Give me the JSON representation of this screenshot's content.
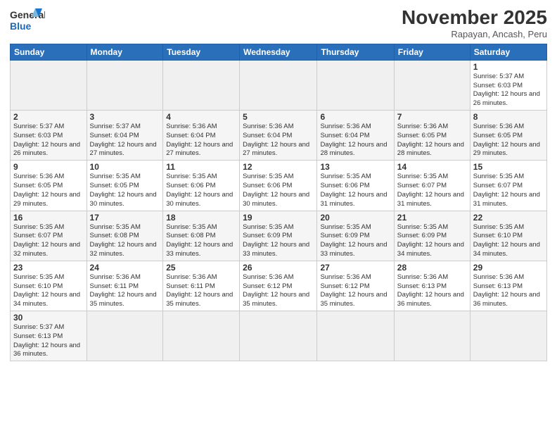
{
  "header": {
    "logo_general": "General",
    "logo_blue": "Blue",
    "month_title": "November 2025",
    "location": "Rapayan, Ancash, Peru"
  },
  "days_of_week": [
    "Sunday",
    "Monday",
    "Tuesday",
    "Wednesday",
    "Thursday",
    "Friday",
    "Saturday"
  ],
  "weeks": [
    [
      {
        "day": "",
        "info": ""
      },
      {
        "day": "",
        "info": ""
      },
      {
        "day": "",
        "info": ""
      },
      {
        "day": "",
        "info": ""
      },
      {
        "day": "",
        "info": ""
      },
      {
        "day": "",
        "info": ""
      },
      {
        "day": "1",
        "info": "Sunrise: 5:37 AM\nSunset: 6:03 PM\nDaylight: 12 hours and 26 minutes."
      }
    ],
    [
      {
        "day": "2",
        "info": "Sunrise: 5:37 AM\nSunset: 6:03 PM\nDaylight: 12 hours and 26 minutes."
      },
      {
        "day": "3",
        "info": "Sunrise: 5:37 AM\nSunset: 6:04 PM\nDaylight: 12 hours and 27 minutes."
      },
      {
        "day": "4",
        "info": "Sunrise: 5:36 AM\nSunset: 6:04 PM\nDaylight: 12 hours and 27 minutes."
      },
      {
        "day": "5",
        "info": "Sunrise: 5:36 AM\nSunset: 6:04 PM\nDaylight: 12 hours and 27 minutes."
      },
      {
        "day": "6",
        "info": "Sunrise: 5:36 AM\nSunset: 6:04 PM\nDaylight: 12 hours and 28 minutes."
      },
      {
        "day": "7",
        "info": "Sunrise: 5:36 AM\nSunset: 6:05 PM\nDaylight: 12 hours and 28 minutes."
      },
      {
        "day": "8",
        "info": "Sunrise: 5:36 AM\nSunset: 6:05 PM\nDaylight: 12 hours and 29 minutes."
      }
    ],
    [
      {
        "day": "9",
        "info": "Sunrise: 5:36 AM\nSunset: 6:05 PM\nDaylight: 12 hours and 29 minutes."
      },
      {
        "day": "10",
        "info": "Sunrise: 5:35 AM\nSunset: 6:05 PM\nDaylight: 12 hours and 30 minutes."
      },
      {
        "day": "11",
        "info": "Sunrise: 5:35 AM\nSunset: 6:06 PM\nDaylight: 12 hours and 30 minutes."
      },
      {
        "day": "12",
        "info": "Sunrise: 5:35 AM\nSunset: 6:06 PM\nDaylight: 12 hours and 30 minutes."
      },
      {
        "day": "13",
        "info": "Sunrise: 5:35 AM\nSunset: 6:06 PM\nDaylight: 12 hours and 31 minutes."
      },
      {
        "day": "14",
        "info": "Sunrise: 5:35 AM\nSunset: 6:07 PM\nDaylight: 12 hours and 31 minutes."
      },
      {
        "day": "15",
        "info": "Sunrise: 5:35 AM\nSunset: 6:07 PM\nDaylight: 12 hours and 31 minutes."
      }
    ],
    [
      {
        "day": "16",
        "info": "Sunrise: 5:35 AM\nSunset: 6:07 PM\nDaylight: 12 hours and 32 minutes."
      },
      {
        "day": "17",
        "info": "Sunrise: 5:35 AM\nSunset: 6:08 PM\nDaylight: 12 hours and 32 minutes."
      },
      {
        "day": "18",
        "info": "Sunrise: 5:35 AM\nSunset: 6:08 PM\nDaylight: 12 hours and 33 minutes."
      },
      {
        "day": "19",
        "info": "Sunrise: 5:35 AM\nSunset: 6:09 PM\nDaylight: 12 hours and 33 minutes."
      },
      {
        "day": "20",
        "info": "Sunrise: 5:35 AM\nSunset: 6:09 PM\nDaylight: 12 hours and 33 minutes."
      },
      {
        "day": "21",
        "info": "Sunrise: 5:35 AM\nSunset: 6:09 PM\nDaylight: 12 hours and 34 minutes."
      },
      {
        "day": "22",
        "info": "Sunrise: 5:35 AM\nSunset: 6:10 PM\nDaylight: 12 hours and 34 minutes."
      }
    ],
    [
      {
        "day": "23",
        "info": "Sunrise: 5:35 AM\nSunset: 6:10 PM\nDaylight: 12 hours and 34 minutes."
      },
      {
        "day": "24",
        "info": "Sunrise: 5:36 AM\nSunset: 6:11 PM\nDaylight: 12 hours and 35 minutes."
      },
      {
        "day": "25",
        "info": "Sunrise: 5:36 AM\nSunset: 6:11 PM\nDaylight: 12 hours and 35 minutes."
      },
      {
        "day": "26",
        "info": "Sunrise: 5:36 AM\nSunset: 6:12 PM\nDaylight: 12 hours and 35 minutes."
      },
      {
        "day": "27",
        "info": "Sunrise: 5:36 AM\nSunset: 6:12 PM\nDaylight: 12 hours and 35 minutes."
      },
      {
        "day": "28",
        "info": "Sunrise: 5:36 AM\nSunset: 6:13 PM\nDaylight: 12 hours and 36 minutes."
      },
      {
        "day": "29",
        "info": "Sunrise: 5:36 AM\nSunset: 6:13 PM\nDaylight: 12 hours and 36 minutes."
      }
    ],
    [
      {
        "day": "30",
        "info": "Sunrise: 5:37 AM\nSunset: 6:13 PM\nDaylight: 12 hours and 36 minutes."
      },
      {
        "day": "",
        "info": ""
      },
      {
        "day": "",
        "info": ""
      },
      {
        "day": "",
        "info": ""
      },
      {
        "day": "",
        "info": ""
      },
      {
        "day": "",
        "info": ""
      },
      {
        "day": "",
        "info": ""
      }
    ]
  ]
}
